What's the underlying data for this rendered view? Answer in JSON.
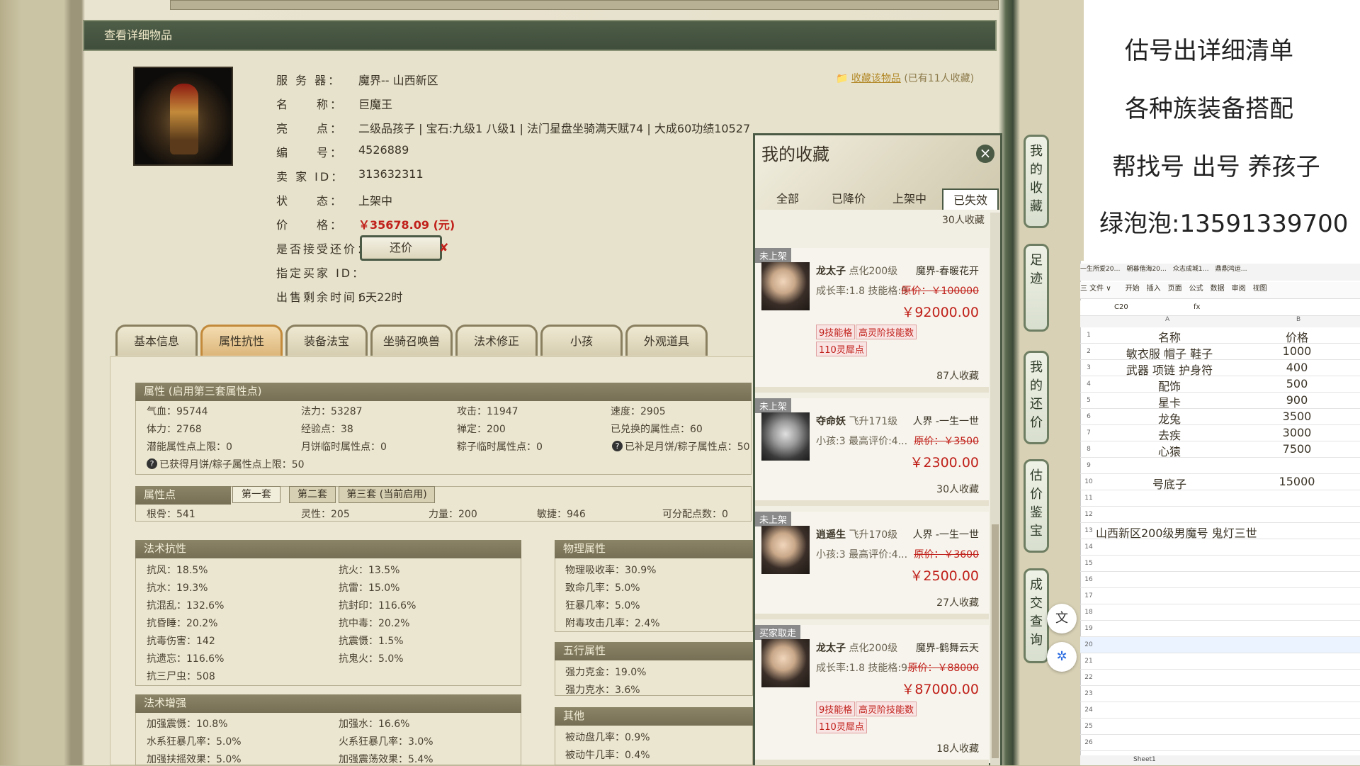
{
  "game": {
    "title_bar": "查看详细物品",
    "favorite_link": "收藏该物品",
    "favorite_count": "(已有11人收藏)",
    "info": [
      {
        "label": "服 务 器：",
        "value": "魔界-- 山西新区"
      },
      {
        "label": "名　　称：",
        "value": "巨魔王"
      },
      {
        "label": "亮　　点：",
        "value": "二级品孩子 | 宝石:九级1 八级1 | 法门星盘坐骑满天赋74 | 大成60功绩10527"
      },
      {
        "label": "编　　号：",
        "value": "4526889"
      },
      {
        "label": "卖 家  ID：",
        "value": "313632311"
      },
      {
        "label": "状　　态：",
        "value": "上架中"
      },
      {
        "label": "价　　格：",
        "value": "￥35678.09 (元)"
      },
      {
        "label": "是否接受还价：",
        "value": ""
      },
      {
        "label": "指定买家 ID：",
        "value": ""
      },
      {
        "label": "出售剩余时间：",
        "value": "6天22时"
      }
    ],
    "offer_button": "还价",
    "tabs": [
      "基本信息",
      "属性抗性",
      "装备法宝",
      "坐骑召唤兽",
      "法术修正",
      "小孩",
      "外观道具"
    ],
    "attr_header": "属性 (启用第三套属性点)",
    "attrs": [
      [
        "气血：95744",
        "法力：53287",
        "攻击：11947",
        "速度：2905"
      ],
      [
        "体力：2768",
        "经验点：38",
        "禅定：200",
        "已兑换的属性点：60"
      ],
      [
        "潜能属性点上限：0",
        "月饼临时属性点：0",
        "粽子临时属性点：0",
        "已补足月饼/粽子属性点：50"
      ],
      [
        "已获得月饼/粽子属性点上限：50"
      ]
    ],
    "points_header": "属性点",
    "point_tabs": [
      "第一套",
      "第二套",
      "第三套 (当前启用)"
    ],
    "points": [
      "根骨：541",
      "灵性：205",
      "力量：200",
      "敏捷：946",
      "可分配点数：0"
    ],
    "resist_header": "法术抗性",
    "resist": [
      [
        "抗风：18.5%",
        "抗火：13.5%"
      ],
      [
        "抗水：19.3%",
        "抗雷：15.0%"
      ],
      [
        "抗混乱：132.6%",
        "抗封印：116.6%"
      ],
      [
        "抗昏睡：20.2%",
        "抗中毒：20.2%"
      ],
      [
        "抗毒伤害：142",
        "抗震慑：1.5%"
      ],
      [
        "抗遗忘：116.6%",
        "抗鬼火：5.0%"
      ],
      [
        "抗三尸虫：508",
        ""
      ]
    ],
    "phys_header": "物理属性",
    "phys": [
      "物理吸收率：30.9%",
      "致命几率：5.0%",
      "狂暴几率：5.0%",
      "附毒攻击几率：2.4%"
    ],
    "wuxing_header": "五行属性",
    "wuxing": [
      "强力克金：19.0%",
      "强力克水：3.6%"
    ],
    "other_header": "其他",
    "other": [
      "被动盘几率：0.9%",
      "被动牛几率：0.4%"
    ],
    "enhance_header": "法术增强",
    "enhance": [
      [
        "加强震慑：10.8%",
        "加强水：16.6%"
      ],
      [
        "水系狂暴几率：5.0%",
        "火系狂暴几率：3.0%"
      ],
      [
        "加强扶摇效果：5.0%",
        "加强震荡效果：5.4%"
      ]
    ]
  },
  "favorites": {
    "title": "我的收藏",
    "tabs": [
      "全部",
      "已降价",
      "上架中",
      "已失效"
    ],
    "top_count": "30人收藏",
    "items": [
      {
        "tag": "未上架",
        "name": "龙太子",
        "level": "点化200级",
        "server": "魔界-春暖花开",
        "line2": "成长率:1.8 技能格:9",
        "orig": "原价：￥100000",
        "price": "￥92000.00",
        "badges": [
          "9技能格",
          "高灵阶技能数",
          "110灵犀点"
        ],
        "count": "87人收藏"
      },
      {
        "tag": "未上架",
        "name": "夺命妖",
        "level": "飞升171级",
        "server": "人界 -一生一世",
        "line2": "小孩:3 最高评价:4...",
        "orig": "原价：￥3500",
        "price": "￥2300.00",
        "badges": [],
        "count": "30人收藏"
      },
      {
        "tag": "未上架",
        "name": "逍遥生",
        "level": "飞升170级",
        "server": "人界 -一生一世",
        "line2": "小孩:3 最高评价:4...",
        "orig": "原价：￥3600",
        "price": "￥2500.00",
        "badges": [],
        "count": "27人收藏"
      },
      {
        "tag": "买家取走",
        "name": "龙太子",
        "level": "点化200级",
        "server": "魔界-鹤舞云天",
        "line2": "成长率:1.8 技能格:9",
        "orig": "原价：￥88000",
        "price": "￥87000.00",
        "badges": [
          "9技能格",
          "高灵阶技能数",
          "110灵犀点"
        ],
        "count": "18人收藏"
      }
    ]
  },
  "side_menu": [
    "我的收藏",
    "足迹",
    "我的还价",
    "估价鉴宝",
    "成交查询"
  ],
  "side_icons": [
    "translate-icon",
    "network-icon"
  ],
  "notes": [
    "估号出详细清单",
    "各种族装备搭配",
    "帮找号 出号 养孩子",
    "绿泡泡:13591339700"
  ],
  "sheet": {
    "cell_ref": "C20",
    "fx": "fx",
    "col_a": "A",
    "col_b": "B",
    "rows": [
      {
        "n": "1",
        "a": "名称",
        "b": "价格"
      },
      {
        "n": "2",
        "a": "敏衣服 帽子 鞋子",
        "b": "1000"
      },
      {
        "n": "3",
        "a": "武器 项链 护身符",
        "b": "400"
      },
      {
        "n": "4",
        "a": "配饰",
        "b": "500"
      },
      {
        "n": "5",
        "a": "星卡",
        "b": "900"
      },
      {
        "n": "6",
        "a": "龙兔",
        "b": "3500"
      },
      {
        "n": "7",
        "a": "去疾",
        "b": "3000"
      },
      {
        "n": "8",
        "a": "心猿",
        "b": "7500"
      },
      {
        "n": "9",
        "a": "",
        "b": ""
      },
      {
        "n": "10",
        "a": "号底子",
        "b": "15000"
      },
      {
        "n": "11",
        "a": "",
        "b": ""
      },
      {
        "n": "12",
        "a": "",
        "b": ""
      },
      {
        "n": "13",
        "a": "山西新区200级男魔号 鬼灯三世",
        "b": ""
      },
      {
        "n": "14",
        "a": "",
        "b": ""
      },
      {
        "n": "15",
        "a": "",
        "b": ""
      },
      {
        "n": "16",
        "a": "",
        "b": ""
      },
      {
        "n": "17",
        "a": "",
        "b": ""
      },
      {
        "n": "18",
        "a": "",
        "b": ""
      },
      {
        "n": "19",
        "a": "",
        "b": ""
      },
      {
        "n": "20",
        "a": "",
        "b": ""
      },
      {
        "n": "21",
        "a": "",
        "b": ""
      },
      {
        "n": "22",
        "a": "",
        "b": ""
      },
      {
        "n": "23",
        "a": "",
        "b": ""
      },
      {
        "n": "24",
        "a": "",
        "b": ""
      },
      {
        "n": "25",
        "a": "",
        "b": ""
      },
      {
        "n": "26",
        "a": "",
        "b": ""
      }
    ],
    "tabs_text": "一生所爱20…　朝暮偕海20…　众志成城1…　鼎鼎鸿运…",
    "toolbar_text": "三 文件 ∨　　开始　插入　页面　公式　数据　审阅　视图",
    "sheet_tab": "Sheet1"
  }
}
